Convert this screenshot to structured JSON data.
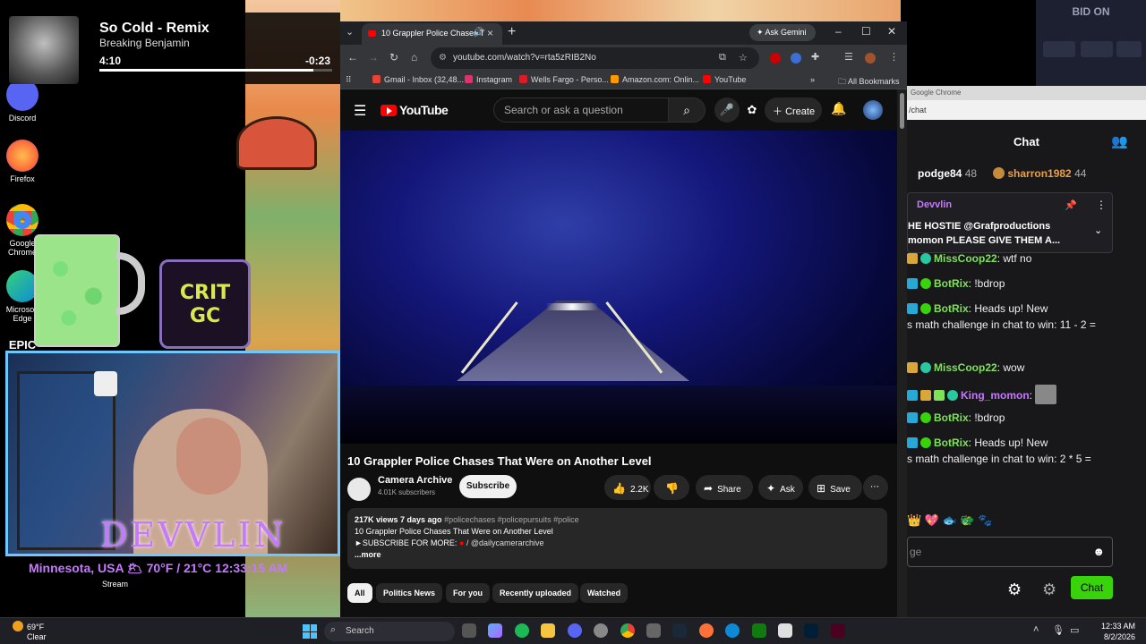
{
  "now_playing": {
    "title": "So Cold - Remix",
    "artist": "Breaking Benjamin",
    "elapsed": "4:10",
    "remaining": "-0:23",
    "progress_fraction": 0.92
  },
  "desktop_icons": [
    {
      "label": "Discord",
      "icon": "discord-icon",
      "color": "#5865f2"
    },
    {
      "label": "Firefox",
      "icon": "firefox-icon",
      "color": "#ff7139"
    },
    {
      "label": "Google Chrome",
      "icon": "chrome-icon",
      "color": "#4285f4"
    },
    {
      "label": "Microsoft Edge",
      "icon": "edge-icon",
      "color": "#0c8ad6"
    },
    {
      "label": "EPIC",
      "icon": "epic-games-icon",
      "color": "#2a2a2a"
    }
  ],
  "overlay": {
    "bid_text": "BID ON",
    "crit_logo_top": "CRIT",
    "crit_logo_bottom": "GC",
    "streamer_name": "DEVVLIN",
    "weather_line": "Minnesota, USA 🌥 70°F / 21°C 12:33:15 AM",
    "stream_label": "Stream"
  },
  "browser": {
    "tab_title": "10 Grappler Police Chases T",
    "ask_gemini": "Ask Gemini",
    "url": "youtube.com/watch?v=rta5zRIB2No",
    "bookmarks": [
      {
        "label": "Gmail - Inbox (32,48...",
        "color": "#ea4335"
      },
      {
        "label": "Instagram",
        "color": "#e1306c"
      },
      {
        "label": "Wells Fargo - Perso...",
        "color": "#d71e28"
      },
      {
        "label": "Amazon.com: Onlin...",
        "color": "#ff9900"
      },
      {
        "label": "YouTube",
        "color": "#ff0000"
      }
    ],
    "all_bookmarks": "All Bookmarks"
  },
  "youtube": {
    "logo_text": "YouTube",
    "search_placeholder": "Search or ask a question",
    "create_label": "Create",
    "video_title": "10 Grappler Police Chases That Were on Another Level",
    "channel_name": "Camera Archive",
    "subscribers": "4.01K subscribers",
    "subscribe_label": "Subscribe",
    "likes": "2.2K",
    "share_label": "Share",
    "ask_label": "Ask",
    "save_label": "Save",
    "description": {
      "stats": "217K views  7 days ago",
      "tags": "#policechases #policepursuits #police",
      "line1": "10 Grappler Police Chases That Were on Another Level",
      "line2_prefix": "►SUBSCRIBE FOR MORE:",
      "line2_handle": "/ @dailycamerarchive",
      "more": "...more"
    },
    "chips": [
      "All",
      "Politics News",
      "For you",
      "Recently uploaded",
      "Watched"
    ]
  },
  "chat": {
    "window_tab": "Google Chrome",
    "url": "/chat",
    "title": "Chat",
    "leaderboard": [
      {
        "name": "podge84",
        "score": "48",
        "color": "#ffffff"
      },
      {
        "name": "sharron1982",
        "score": "44",
        "color": "#e8a04a"
      }
    ],
    "pinned_user": "Devvlin",
    "pinned_line1": "HE HOSTIE @Grafproductions",
    "pinned_line2": "momon PLEASE GIVE THEM A...",
    "messages": [
      {
        "user": "MissCoop22",
        "color": "#7fe05a",
        "text": ": wtf no"
      },
      {
        "user": "BotRix",
        "color": "#7fe05a",
        "text": ": !bdrop"
      },
      {
        "user": "BotRix",
        "color": "#7fe05a",
        "text": ":        Heads up! New",
        "cont": "s math challenge in chat to win: 11 - 2 ="
      },
      {
        "user": "MissCoop22",
        "color": "#7fe05a",
        "text": ": wow"
      },
      {
        "user": "King_momon",
        "color": "#c678ff",
        "text": ":"
      },
      {
        "user": "BotRix",
        "color": "#7fe05a",
        "text": ": !bdrop"
      },
      {
        "user": "BotRix",
        "color": "#7fe05a",
        "text": ":        Heads up! New",
        "cont": "s math challenge in chat to win: 2 * 5 ="
      }
    ],
    "input_placeholder": "ge",
    "send_label": "Chat"
  },
  "taskbar": {
    "temp": "69°F",
    "condition": "Clear",
    "search": "Search",
    "time": "12:33 AM",
    "date": "8/2/2026"
  }
}
